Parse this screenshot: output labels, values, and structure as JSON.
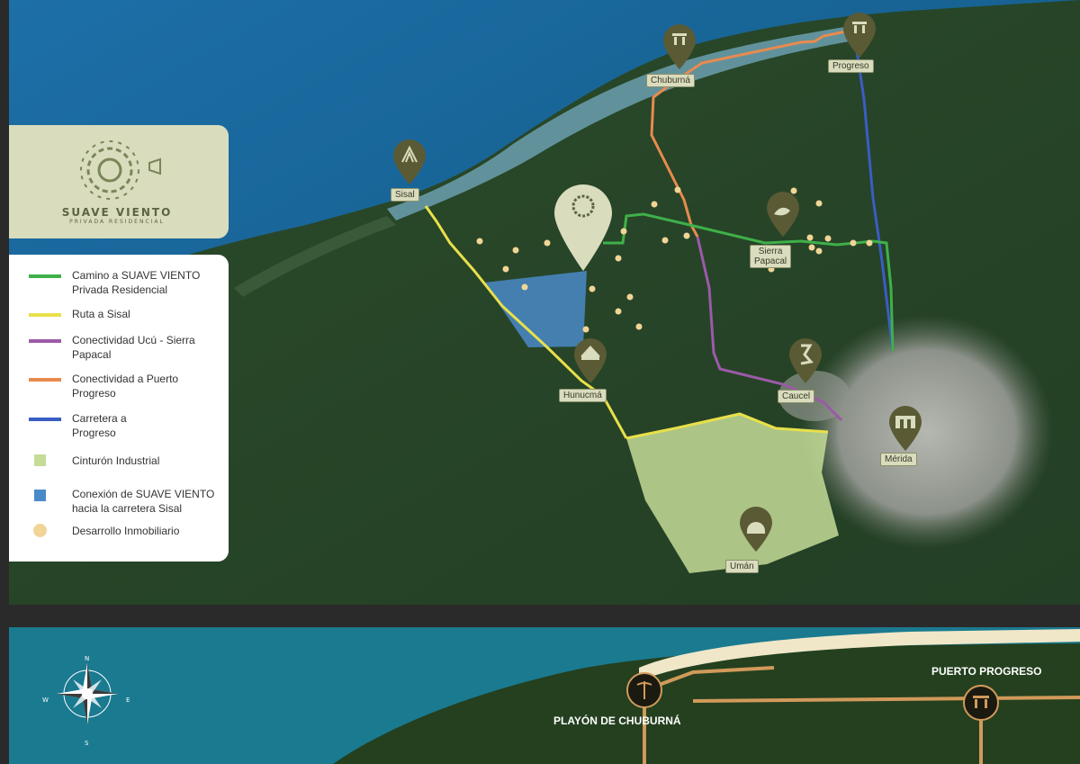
{
  "brand": {
    "name": "SUAVE VIENTO",
    "tagline": "PRIVADA RESIDENCIAL"
  },
  "legend": [
    {
      "label": "Camino a SUAVE VIENTO\nPrivada Residencial",
      "kind": "line",
      "color": "#3fb04a"
    },
    {
      "label": "Ruta a Sisal",
      "kind": "line",
      "color": "#e8e04a"
    },
    {
      "label": "Conectividad Ucú - Sierra Papacal",
      "kind": "line",
      "color": "#9b5aa8"
    },
    {
      "label": "Conectividad a Puerto Progreso",
      "kind": "line",
      "color": "#e98a4e"
    },
    {
      "label": "Carretera a Progreso",
      "kind": "line",
      "color": "#3a5dc4"
    },
    {
      "label": "Cinturón Industrial",
      "kind": "square",
      "color": "#c4dc98"
    },
    {
      "label": "Conexión de SUAVE VIENTO hacia la carretera Sisal",
      "kind": "square",
      "color": "#4a89c8"
    },
    {
      "label": "Desarrollo Inmobiliario",
      "kind": "dot",
      "color": "#f1d597"
    }
  ],
  "places": {
    "progreso": "Progreso",
    "chuburna": "Chuburná",
    "sisal": "Sisal",
    "sierra_papacal": "Sierra\nPapacal",
    "hunucma": "Hunucmá",
    "caucel": "Caucel",
    "merida": "Mérida",
    "uman": "Umán"
  },
  "bottom_map": {
    "playon": "PLAYÓN DE CHUBURNÁ",
    "puerto": "PUERTO PROGRESO",
    "compass": {
      "n": "N",
      "e": "E",
      "s": "S",
      "w": "W"
    }
  },
  "colors": {
    "pin": "#5a5a34",
    "pin_main": "#d9dcbd",
    "sea": "#1a6a9a",
    "land": "#1f3d22"
  }
}
